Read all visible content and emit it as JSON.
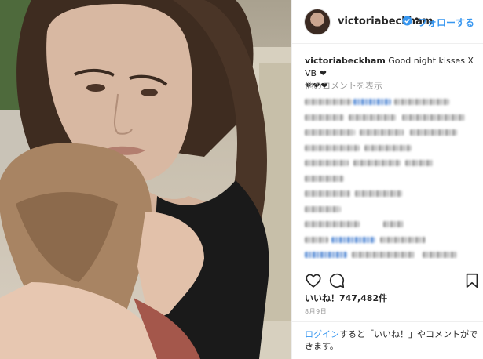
{
  "post": {
    "photo_alt": "Selfie of a woman with long brown hair hugging a young child"
  },
  "header": {
    "username": "victoriabeckham",
    "verified_icon": "verified-badge-icon",
    "separator": "•",
    "follow_label": "フォローする"
  },
  "caption": {
    "username": "victoriabeckham",
    "text": "Good night kisses X VB ",
    "trailing_hearts": "❤",
    "hearts_line": "❤❤❤"
  },
  "comments": {
    "more_label": "他のコメントを表示"
  },
  "actions": {
    "like_icon": "heart-outline-icon",
    "comment_icon": "comment-bubble-icon",
    "save_icon": "bookmark-icon"
  },
  "likes": {
    "label": "いいね！747,482件"
  },
  "date": {
    "label": "8月9日"
  },
  "login": {
    "link_label": "ログイン",
    "rest_label": "すると「いいね！」やコメントができます。"
  },
  "colors": {
    "accent": "#3897f0",
    "text": "#262626",
    "muted": "#999999",
    "border": "#efefef"
  }
}
